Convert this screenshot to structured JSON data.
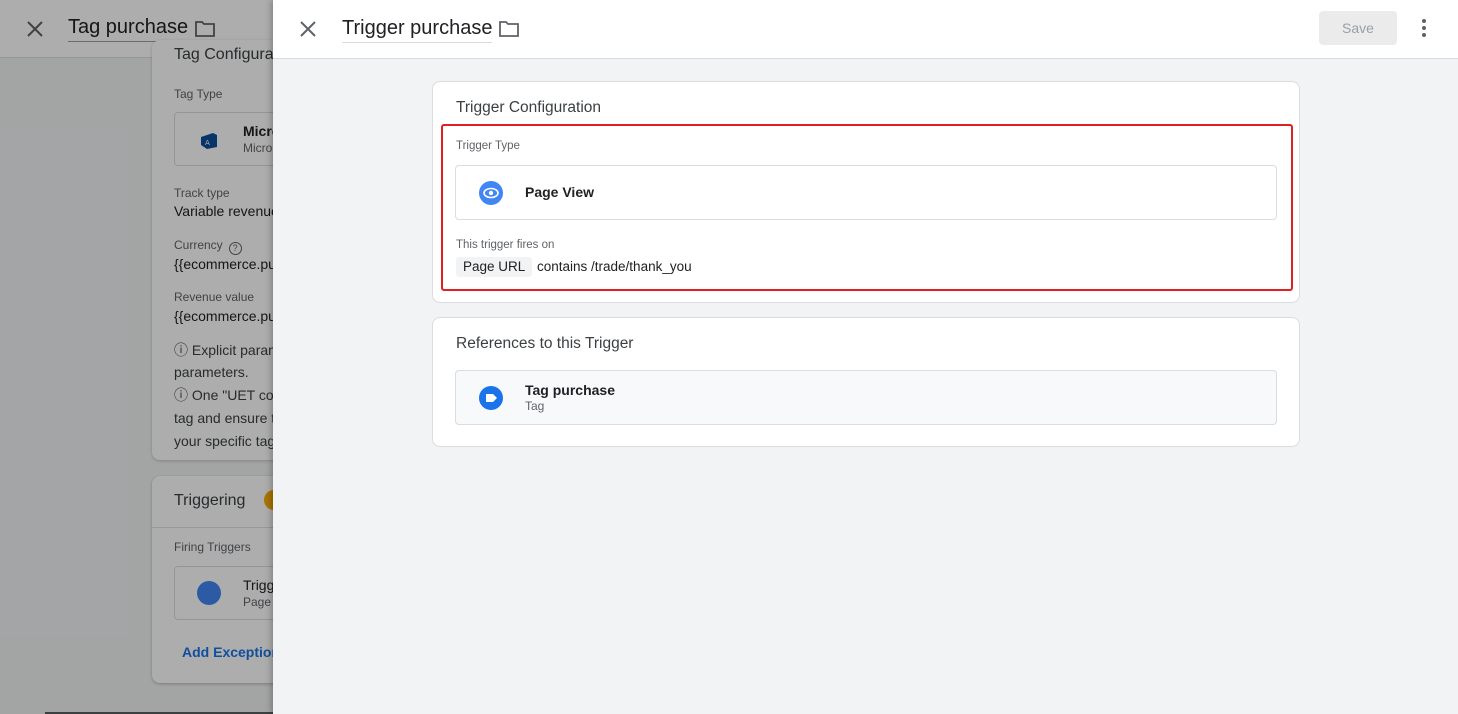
{
  "background_editor": {
    "title": "Tag purchase",
    "config_title": "Tag Configurat",
    "tag_type_label": "Tag Type",
    "tag_type_name": "Micro",
    "tag_type_sub": "Micro",
    "track_type_label": "Track type",
    "track_type_value": "Variable revenue",
    "currency_label": "Currency",
    "currency_value": "{{ecommerce.pu",
    "revenue_label": "Revenue value",
    "revenue_value": "{{ecommerce.pu",
    "note_line1": "ⓘ Explicit param",
    "note_line2": "parameters.",
    "note_line3": "ⓘ One \"UET con",
    "note_line4": "tag and ensure t",
    "note_line5": "your specific tag",
    "triggering_title": "Triggering",
    "firing_triggers_label": "Firing Triggers",
    "firing_trigger_name": "Trigg",
    "firing_trigger_sub": "Page",
    "add_exception": "Add Exception"
  },
  "panel": {
    "title": "Trigger purchase",
    "save_label": "Save"
  },
  "trigger_config": {
    "title": "Trigger Configuration",
    "type_label": "Trigger Type",
    "type_name": "Page View",
    "fires_on_label": "This trigger fires on",
    "condition_variable": "Page URL",
    "condition_text": "contains /trade/thank_you"
  },
  "references": {
    "title": "References to this Trigger",
    "items": [
      {
        "name": "Tag purchase",
        "type": "Tag"
      }
    ]
  },
  "colors": {
    "highlight": "#e02020",
    "accent_blue": "#1a73e8",
    "trigger_icon": "#4285f4"
  }
}
